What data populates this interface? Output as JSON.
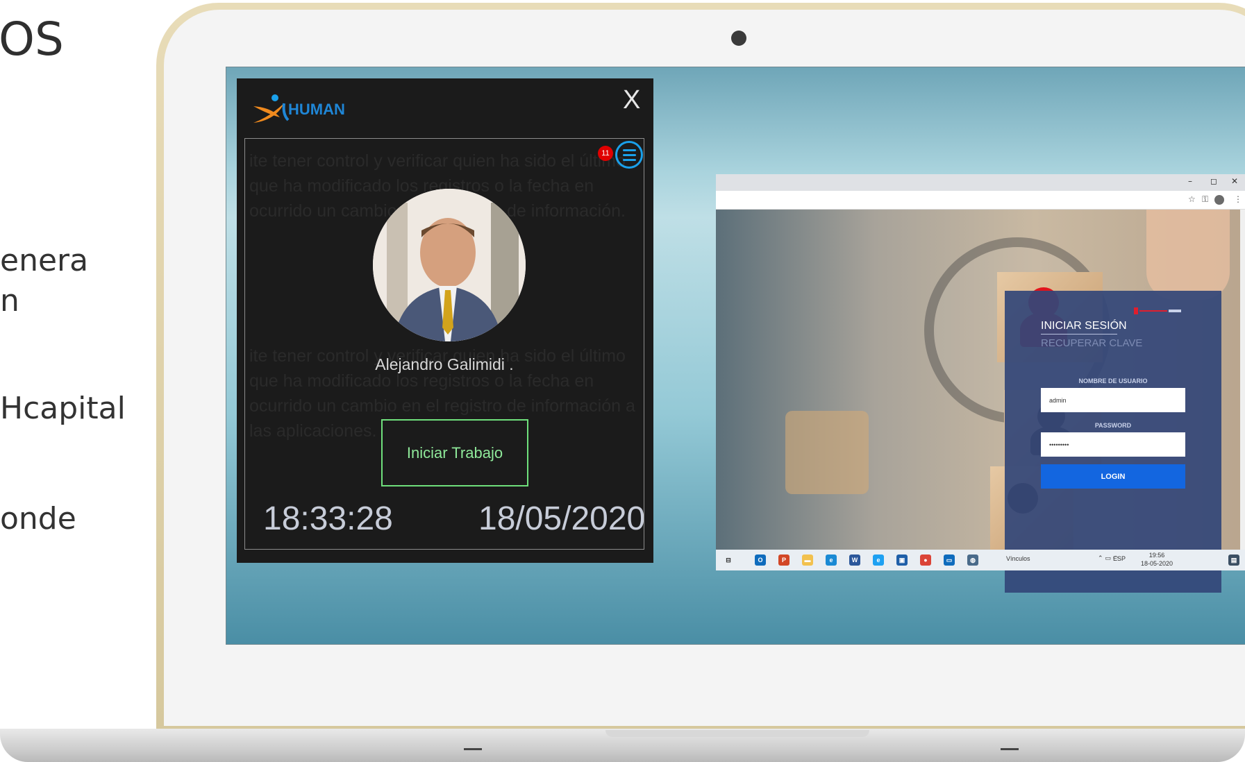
{
  "slide": {
    "title": "OS",
    "line1": "enera",
    "line2": "n",
    "line3": "Hcapital",
    "line4": "onde"
  },
  "widget": {
    "brand": "HUMAN",
    "close_label": "X",
    "notification_count": "11",
    "user_name": "Alejandro Galimidi .",
    "start_button": "Iniciar Trabajo",
    "time": "18:33:28",
    "date": "18/05/2020",
    "ghost_text_a": "ite tener control y verificar quien ha sido el último que ha modificado los registros o la fecha en ocurrido un cambio en el registro de información.",
    "ghost_text_b": "ite tener control y verificar quien ha sido el último que ha modificado los registros o la fecha en ocurrido un cambio en el registro de información a las aplicaciones."
  },
  "browser": {
    "window_controls": [
      "–",
      "◻",
      "✕"
    ],
    "address_icons": [
      "☆",
      "⚿",
      "⋮"
    ],
    "login": {
      "title": "INICIAR SESIÓN",
      "recover": "RECUPERAR CLAVE",
      "username_label": "NOMBRE DE USUARIO",
      "username_value": "admin",
      "password_label": "PASSWORD",
      "password_value": "•••••••••",
      "button": "LOGIN"
    }
  },
  "taskbar": {
    "links": "Vínculos",
    "lang": "ESP",
    "time": "19:56",
    "date": "18-05-2020",
    "apps": [
      {
        "name": "task-view-icon",
        "label": "⊟",
        "color": "#e9eef3"
      },
      {
        "name": "outlook-icon",
        "label": "O",
        "color": "#0f6cbd"
      },
      {
        "name": "powerpoint-icon",
        "label": "P",
        "color": "#d24726"
      },
      {
        "name": "file-explorer-icon",
        "label": "▬",
        "color": "#f2c14e"
      },
      {
        "name": "edge-icon",
        "label": "e",
        "color": "#1a8ad4"
      },
      {
        "name": "word-icon",
        "label": "W",
        "color": "#2b579a"
      },
      {
        "name": "internet-explorer-icon",
        "label": "e",
        "color": "#1ea1f2"
      },
      {
        "name": "store-icon",
        "label": "▣",
        "color": "#1f5fa8"
      },
      {
        "name": "chrome-icon",
        "label": "●",
        "color": "#db4437"
      },
      {
        "name": "window-icon",
        "label": "▭",
        "color": "#0f6cbd"
      },
      {
        "name": "app-icon",
        "label": "◍",
        "color": "#4a6b8a"
      }
    ]
  },
  "colors": {
    "accent_blue": "#1aa0ea",
    "start_green": "#6fe07c",
    "login_button": "#1366e0",
    "badge_red": "#e00000",
    "brand_blue": "#1f86d6",
    "brand_orange": "#f08a1e"
  }
}
